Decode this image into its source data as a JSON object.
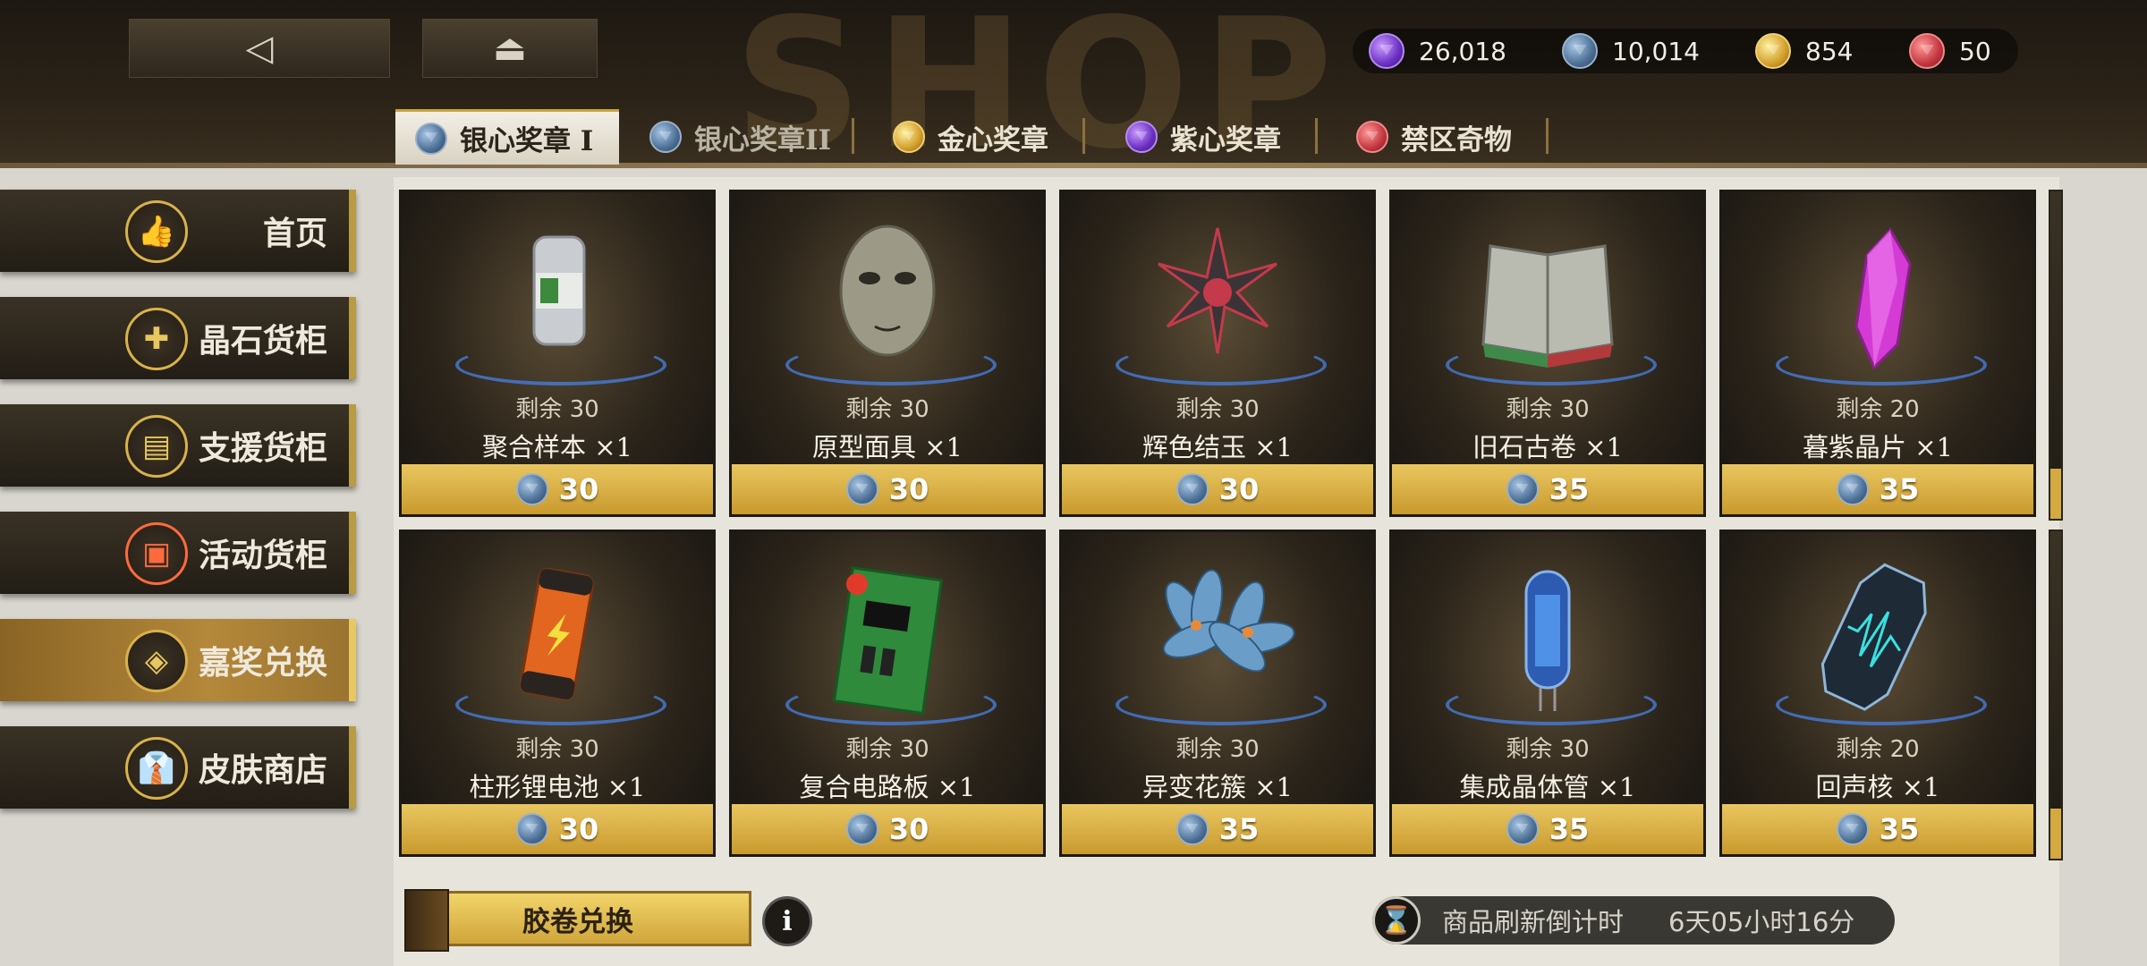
{
  "header": {
    "back_icon": "◁",
    "home_icon": "⏏",
    "bg_watermark": "SHOP"
  },
  "currencies": [
    {
      "icon": "purple-gem",
      "value": "26,018"
    },
    {
      "icon": "silver-gem",
      "value": "10,014"
    },
    {
      "icon": "gold-gem",
      "value": "854"
    },
    {
      "icon": "red-gem",
      "value": "50"
    }
  ],
  "tabs": [
    {
      "label": "银心奖章 I",
      "icon": "silver-gem",
      "active": true
    },
    {
      "label": "银心奖章II",
      "icon": "silver-gem",
      "active": false
    },
    {
      "label": "金心奖章",
      "icon": "gold-gem",
      "active": false
    },
    {
      "label": "紫心奖章",
      "icon": "purple-gem",
      "active": false
    },
    {
      "label": "禁区奇物",
      "icon": "red-gem",
      "active": false
    }
  ],
  "sidebar": [
    {
      "label": "首页",
      "icon": "👍"
    },
    {
      "label": "晶石货柜",
      "icon": "✚"
    },
    {
      "label": "支援货柜",
      "icon": "▤"
    },
    {
      "label": "活动货柜",
      "icon": "▣"
    },
    {
      "label": "嘉奖兑换",
      "icon": "◈"
    },
    {
      "label": "皮肤商店",
      "icon": "👔"
    }
  ],
  "items": [
    {
      "remain": "剩余 30",
      "name": "聚合样本 ×1",
      "price": "30",
      "art": "canister"
    },
    {
      "remain": "剩余 30",
      "name": "原型面具 ×1",
      "price": "30",
      "art": "mask"
    },
    {
      "remain": "剩余 30",
      "name": "辉色结玉 ×1",
      "price": "30",
      "art": "spike"
    },
    {
      "remain": "剩余 30",
      "name": "旧石古卷 ×1",
      "price": "35",
      "art": "book"
    },
    {
      "remain": "剩余 20",
      "name": "暮紫晶片 ×1",
      "price": "35",
      "art": "crystal"
    },
    {
      "remain": "剩余 30",
      "name": "柱形锂电池 ×1",
      "price": "30",
      "art": "battery"
    },
    {
      "remain": "剩余 30",
      "name": "复合电路板 ×1",
      "price": "30",
      "art": "circuit"
    },
    {
      "remain": "剩余 30",
      "name": "异变花簇 ×1",
      "price": "35",
      "art": "flower"
    },
    {
      "remain": "剩余 30",
      "name": "集成晶体管 ×1",
      "price": "35",
      "art": "tube"
    },
    {
      "remain": "剩余 20",
      "name": "回声核 ×1",
      "price": "35",
      "art": "core"
    }
  ],
  "footer": {
    "film_exchange": "胶卷兑换",
    "info_icon": "i",
    "timer_label": "商品刷新倒计时",
    "timer_value": "6天05小时16分",
    "hourglass_icon": "⌛"
  }
}
